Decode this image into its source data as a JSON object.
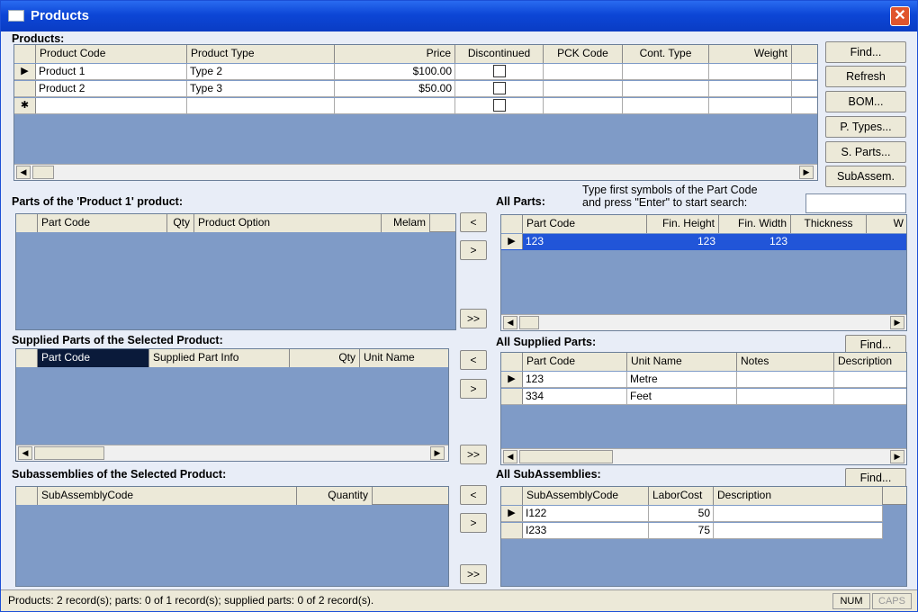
{
  "window": {
    "title": "Products",
    "close_glyph": "✕"
  },
  "products": {
    "label": "Products:",
    "columns": [
      "Product Code",
      "Product Type",
      "Price",
      "Discontinued",
      "PCK Code",
      "Cont. Type",
      "Weight"
    ],
    "rows": [
      {
        "code": "Product 1",
        "type": "Type 2",
        "price": "$100.00"
      },
      {
        "code": "Product 2",
        "type": "Type 3",
        "price": "$50.00"
      }
    ],
    "new_row_marker": "✱",
    "current_row_marker": "▶"
  },
  "side_buttons": [
    "Find...",
    "Refresh",
    "BOM...",
    "P. Types...",
    "S. Parts...",
    "SubAssem."
  ],
  "parts": {
    "label": "Parts of the 'Product 1' product:",
    "columns": [
      "Part Code",
      "Qty",
      "Product Option",
      "Melam"
    ]
  },
  "all_parts": {
    "label": "All Parts:",
    "hint_line1": "Type first symbols of the Part Code",
    "hint_line2": "and press \"Enter\" to start search:",
    "search_value": "",
    "columns": [
      "Part Code",
      "Fin. Height",
      "Fin. Width",
      "Thickness",
      "W"
    ],
    "rows": [
      {
        "code": "123",
        "height": "123",
        "width": "123"
      }
    ]
  },
  "supplied": {
    "label": "Supplied Parts of the Selected Product:",
    "columns": [
      "Part Code",
      "Supplied Part Info",
      "Qty",
      "Unit Name"
    ]
  },
  "all_supplied": {
    "label": "All Supplied Parts:",
    "find": "Find...",
    "columns": [
      "Part Code",
      "Unit Name",
      "Notes",
      "Description"
    ],
    "rows": [
      {
        "code": "123",
        "unit": "Metre"
      },
      {
        "code": "334",
        "unit": "Feet"
      }
    ]
  },
  "subs": {
    "label": "Subassemblies of the Selected Product:",
    "columns": [
      "SubAssemblyCode",
      "Quantity"
    ]
  },
  "all_subs": {
    "label": "All SubAssemblies:",
    "find": "Find...",
    "columns": [
      "SubAssemblyCode",
      "LaborCost",
      "Description"
    ],
    "rows": [
      {
        "code": "I122",
        "cost": "50"
      },
      {
        "code": "I233",
        "cost": "75"
      }
    ]
  },
  "transfer": {
    "left": "<",
    "right": ">",
    "all": ">>"
  },
  "status": {
    "text": "Products: 2 record(s); parts: 0 of 1 record(s); supplied parts: 0 of 2 record(s).",
    "num": "NUM",
    "caps": "CAPS"
  }
}
